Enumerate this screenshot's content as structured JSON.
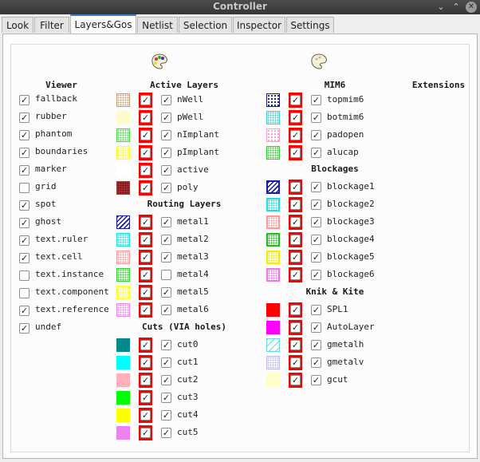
{
  "window": {
    "title": "Controller"
  },
  "tabs": [
    "Look",
    "Filter",
    "Layers&Gos",
    "Netlist",
    "Selection",
    "Inspector",
    "Settings"
  ],
  "active_tab": "Layers&Gos",
  "viewer": {
    "header": "Viewer",
    "items": [
      {
        "label": "fallback",
        "checked": true
      },
      {
        "label": "rubber",
        "checked": true
      },
      {
        "label": "phantom",
        "checked": true
      },
      {
        "label": "boundaries",
        "checked": true
      },
      {
        "label": "marker",
        "checked": true
      },
      {
        "label": "grid",
        "checked": false
      },
      {
        "label": "spot",
        "checked": true
      },
      {
        "label": "ghost",
        "checked": true
      },
      {
        "label": "text.ruler",
        "checked": true
      },
      {
        "label": "text.cell",
        "checked": true
      },
      {
        "label": "text.instance",
        "checked": false
      },
      {
        "label": "text.component",
        "checked": false
      },
      {
        "label": "text.reference",
        "checked": true
      },
      {
        "label": "undef",
        "checked": true
      }
    ]
  },
  "active_layers": {
    "header": "Active Layers",
    "items": [
      {
        "label": "nWell",
        "color": "#c8a078",
        "pattern": "dots",
        "checked": true
      },
      {
        "label": "pWell",
        "color": "#fffccc",
        "pattern": "solid",
        "checked": true
      },
      {
        "label": "nImplant",
        "color": "#44dd44",
        "pattern": "dots",
        "checked": true
      },
      {
        "label": "pImplant",
        "color": "#ffff22",
        "pattern": "dots",
        "checked": true
      },
      {
        "label": "active",
        "color": "#ffffff",
        "pattern": "solid",
        "checked": true
      },
      {
        "label": "poly",
        "color": "#b03030",
        "pattern": "cross",
        "checked": true
      }
    ]
  },
  "routing_layers": {
    "header": "Routing Layers",
    "items": [
      {
        "label": "metal1",
        "color": "#1a1aaa",
        "pattern": "diag",
        "checked": true
      },
      {
        "label": "metal2",
        "color": "#22dddd",
        "pattern": "dots",
        "checked": true
      },
      {
        "label": "metal3",
        "color": "#ff9999",
        "pattern": "dots",
        "checked": true
      },
      {
        "label": "metal4",
        "color": "#33cc33",
        "pattern": "dots",
        "checked": false
      },
      {
        "label": "metal5",
        "color": "#ffff33",
        "pattern": "dots",
        "checked": true
      },
      {
        "label": "metal6",
        "color": "#ee88ee",
        "pattern": "dots",
        "checked": true
      }
    ]
  },
  "cuts": {
    "header": "Cuts (VIA holes)",
    "items": [
      {
        "label": "cut0",
        "color": "#008a8a",
        "pattern": "solid",
        "checked": true
      },
      {
        "label": "cut1",
        "color": "#00ffff",
        "pattern": "solid",
        "checked": true
      },
      {
        "label": "cut2",
        "color": "#ffb0b8",
        "pattern": "solid",
        "checked": true
      },
      {
        "label": "cut3",
        "color": "#00ff00",
        "pattern": "solid",
        "checked": true
      },
      {
        "label": "cut4",
        "color": "#ffff00",
        "pattern": "solid",
        "checked": true
      },
      {
        "label": "cut5",
        "color": "#ee82ee",
        "pattern": "solid",
        "checked": true
      }
    ]
  },
  "mim6": {
    "header": "MIM6",
    "items": [
      {
        "label": "topmim6",
        "color": "#1a1a88",
        "pattern": "sparse",
        "checked": true
      },
      {
        "label": "botmim6",
        "color": "#44cccc",
        "pattern": "dots",
        "checked": true
      },
      {
        "label": "padopen",
        "color": "#ff99cc",
        "pattern": "sparse",
        "checked": true
      },
      {
        "label": "alucap",
        "color": "#33cc33",
        "pattern": "dots",
        "checked": true
      }
    ]
  },
  "extensions": {
    "header": "Extensions"
  },
  "blockages": {
    "header": "Blockages",
    "items": [
      {
        "label": "blockage1",
        "color": "#1a1aaa",
        "pattern": "diagbox",
        "checked": true
      },
      {
        "label": "blockage2",
        "color": "#22dddd",
        "pattern": "dotbox",
        "checked": true
      },
      {
        "label": "blockage3",
        "color": "#ff9999",
        "pattern": "dotbox",
        "checked": true
      },
      {
        "label": "blockage4",
        "color": "#22bb22",
        "pattern": "dotbox",
        "checked": true
      },
      {
        "label": "blockage5",
        "color": "#eeee00",
        "pattern": "dotbox",
        "checked": true
      },
      {
        "label": "blockage6",
        "color": "#ee77ee",
        "pattern": "dotbox",
        "checked": true
      }
    ]
  },
  "knik_kite": {
    "header": "Knik & Kite",
    "items": [
      {
        "label": "SPL1",
        "color": "#ff0000",
        "pattern": "solid",
        "checked": true
      },
      {
        "label": "AutoLayer",
        "color": "#ff00ff",
        "pattern": "solid",
        "checked": true
      },
      {
        "label": "gmetalh",
        "color": "#66dddd",
        "pattern": "diaglight",
        "checked": true
      },
      {
        "label": "gmetalv",
        "color": "#bbbbee",
        "pattern": "dots",
        "checked": true
      },
      {
        "label": "gcut",
        "color": "#ffffcc",
        "pattern": "solid",
        "checked": true
      }
    ]
  },
  "icons": [
    "palette-icon",
    "palette-icon",
    "close-icon",
    "minimize-icon"
  ]
}
